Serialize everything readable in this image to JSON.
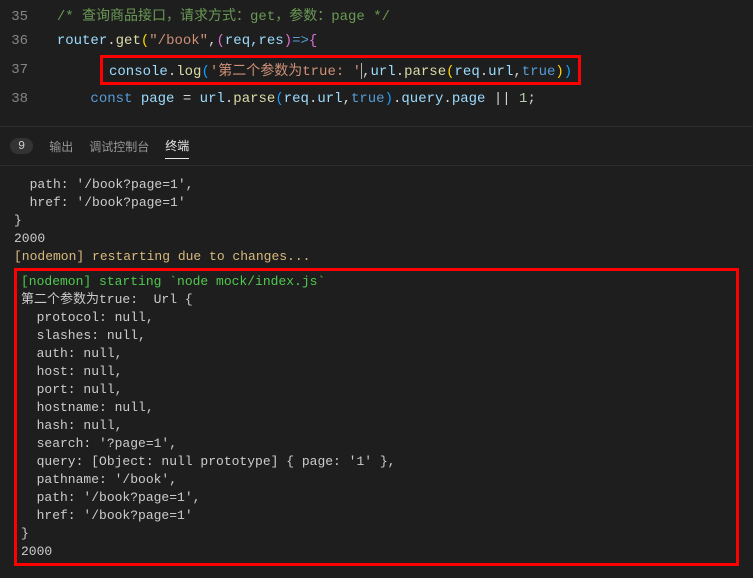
{
  "editor": {
    "lines": {
      "35": {
        "num": "35",
        "comment": "/* 查询商品接口，请求方式：get，参数：page */"
      },
      "36": {
        "num": "36",
        "prefix": "router",
        "method": "get",
        "path": "\"/book\"",
        "args": "req,res"
      },
      "37": {
        "num": "37",
        "console": "console",
        "log": "log",
        "str": "'第二个参数为true: '",
        "url": "url",
        "parse": "parse",
        "req": "req",
        "urlprop": "url",
        "true": "true"
      },
      "38": {
        "num": "38",
        "const": "const",
        "page": "page",
        "url": "url",
        "parse": "parse",
        "req": "req",
        "urlprop": "url",
        "true": "true",
        "query": "query",
        "pageprop": "page",
        "one": "1"
      }
    }
  },
  "panel": {
    "badge": "9",
    "tabs": {
      "output": "输出",
      "debug": "调试控制台",
      "terminal": "终端"
    }
  },
  "terminal": {
    "pre": {
      "l1": "  path: '/book?page=1',",
      "l2": "  href: '/book?page=1'",
      "l3": "}",
      "l4": "2000",
      "l5": "[nodemon] restarting due to changes..."
    },
    "box": {
      "l1": "[nodemon] starting `node mock/index.js`",
      "l2": "第二个参数为true:  Url {",
      "l3": "  protocol: null,",
      "l4": "  slashes: null,",
      "l5": "  auth: null,",
      "l6": "  host: null,",
      "l7": "  port: null,",
      "l8": "  hostname: null,",
      "l9": "  hash: null,",
      "l10": "  search: '?page=1',",
      "l11": "  query: [Object: null prototype] { page: '1' },",
      "l12": "  pathname: '/book',",
      "l13": "  path: '/book?page=1',",
      "l14": "  href: '/book?page=1'",
      "l15": "}",
      "l16": "2000"
    }
  }
}
